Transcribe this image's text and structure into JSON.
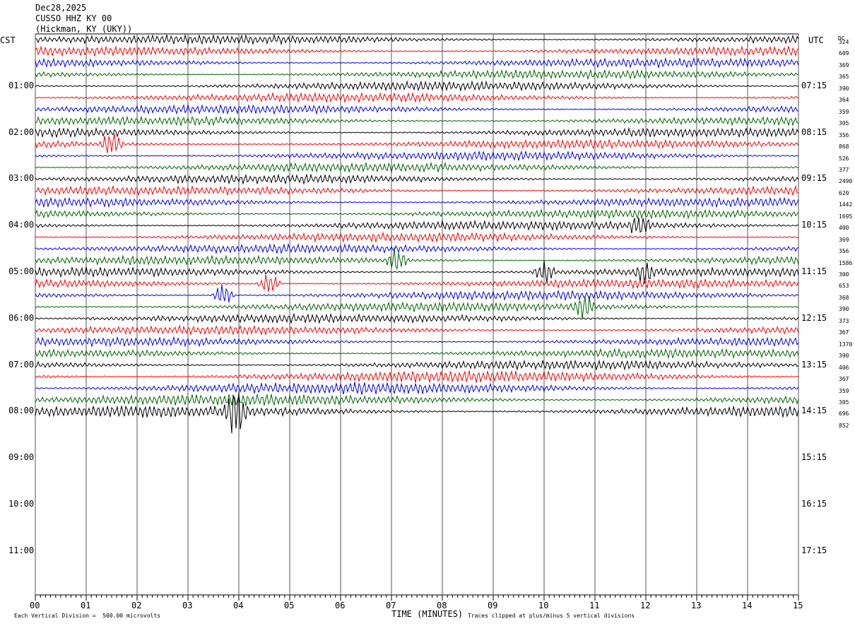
{
  "header": {
    "date": "Dec28,2025",
    "station": "CUSSO HHZ KY 00",
    "location": "(Hickman, KY (UKY))"
  },
  "left_tz": "CST",
  "right_tz": "UTC",
  "dc_label": "DC",
  "footer": {
    "x_axis_title": "TIME (MINUTES)",
    "scale_note": "Each Vertical Division =  500.00 microvolts",
    "clip_note": "Traces clipped at plus/minus 5 vertical divisions"
  },
  "colors": {
    "trace_cycle": [
      "#000000",
      "#ff0000",
      "#0000ff",
      "#006400"
    ],
    "grid": "#000000"
  },
  "chart_data": {
    "type": "line",
    "title": "Dec28,2025 CUSSO HHZ KY 00 (Hickman, KY (UKY))",
    "xlabel": "TIME (MINUTES)",
    "x_ticks": [
      "00",
      "01",
      "02",
      "03",
      "04",
      "05",
      "06",
      "07",
      "08",
      "09",
      "10",
      "11",
      "12",
      "13",
      "14",
      "15"
    ],
    "xlim": [
      0,
      15
    ],
    "left_hours": [
      "01:00",
      "02:00",
      "03:00",
      "04:00",
      "05:00",
      "06:00",
      "07:00",
      "08:00",
      "09:00",
      "10:00",
      "11:00"
    ],
    "right_hours": [
      "07:15",
      "08:15",
      "09:15",
      "10:15",
      "11:15",
      "12:15",
      "13:15",
      "14:15",
      "15:15",
      "16:15",
      "17:15"
    ],
    "traces_per_hour": 4,
    "minutes_per_trace": 15,
    "dc_offsets": [
      "324",
      "609",
      "369",
      "365",
      "390",
      "364",
      "359",
      "305",
      "356",
      "868",
      "526",
      "377",
      "2490",
      "620",
      "1442",
      "1695",
      "400",
      "369",
      "356",
      "1586",
      "300",
      "653",
      "368",
      "390",
      "373",
      "367",
      "1370",
      "390",
      "406",
      "367",
      "359",
      "305",
      "696",
      "852"
    ],
    "trace_count": 33,
    "amplitude_unit": "500.00 microvolts per vertical division",
    "clip_limit_divisions": 5,
    "events": [
      {
        "trace": 9,
        "minute": 1.5
      },
      {
        "trace": 16,
        "minute": 11.9
      },
      {
        "trace": 19,
        "minute": 7.1
      },
      {
        "trace": 20,
        "minute": 10.0
      },
      {
        "trace": 20,
        "minute": 12.0
      },
      {
        "trace": 21,
        "minute": 4.6
      },
      {
        "trace": 22,
        "minute": 3.7
      },
      {
        "trace": 23,
        "minute": 10.8
      },
      {
        "trace": 32,
        "minute": 3.95
      }
    ]
  }
}
